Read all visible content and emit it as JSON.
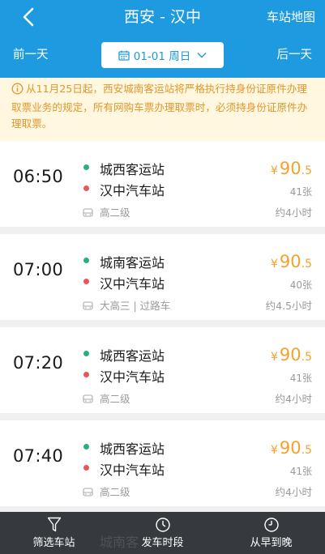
{
  "header": {
    "title": "西安 - 汉中",
    "map_link": "车站地图",
    "prev_day": "前一天",
    "next_day": "后一天",
    "date": "01-01 周日"
  },
  "notice": {
    "text": "从11月25日起，西安城南客运站将严格执行持身份证原件办理取票业务的规定，所有网购车票办理取票时，必须持身份证原件办理取票。"
  },
  "trips": [
    {
      "time": "06:50",
      "from": "城西客运站",
      "to": "汉中汽车站",
      "price_symbol": "¥",
      "price_int": "90",
      "price_dec": ".5",
      "seats": "41张",
      "bus_type": "高二级",
      "duration": "约4小时"
    },
    {
      "time": "07:00",
      "from": "城南客运站",
      "to": "汉中汽车站",
      "price_symbol": "¥",
      "price_int": "90",
      "price_dec": ".5",
      "seats": "40张",
      "bus_type": "大高三 | 过路车",
      "duration": "约4.5小时"
    },
    {
      "time": "07:20",
      "from": "城西客运站",
      "to": "汉中汽车站",
      "price_symbol": "¥",
      "price_int": "90",
      "price_dec": ".5",
      "seats": "41张",
      "bus_type": "高二级",
      "duration": "约4小时"
    },
    {
      "time": "07:40",
      "from": "城西客运站",
      "to": "汉中汽车站",
      "price_symbol": "¥",
      "price_int": "90",
      "price_dec": ".5",
      "seats": "41张",
      "bus_type": "高二级",
      "duration": "约4小时"
    }
  ],
  "peek_station": "城南客",
  "bottom_bar": {
    "filter_label": "筛选车站",
    "period_label": "发车时段",
    "sort_label": "从早到晚"
  },
  "colors": {
    "header": "#1e9be0",
    "price": "#f4a22c",
    "notice_bg": "#fff7df",
    "notice_text": "#e2962c",
    "from_dot": "#27b07a",
    "to_dot": "#e9575a"
  }
}
